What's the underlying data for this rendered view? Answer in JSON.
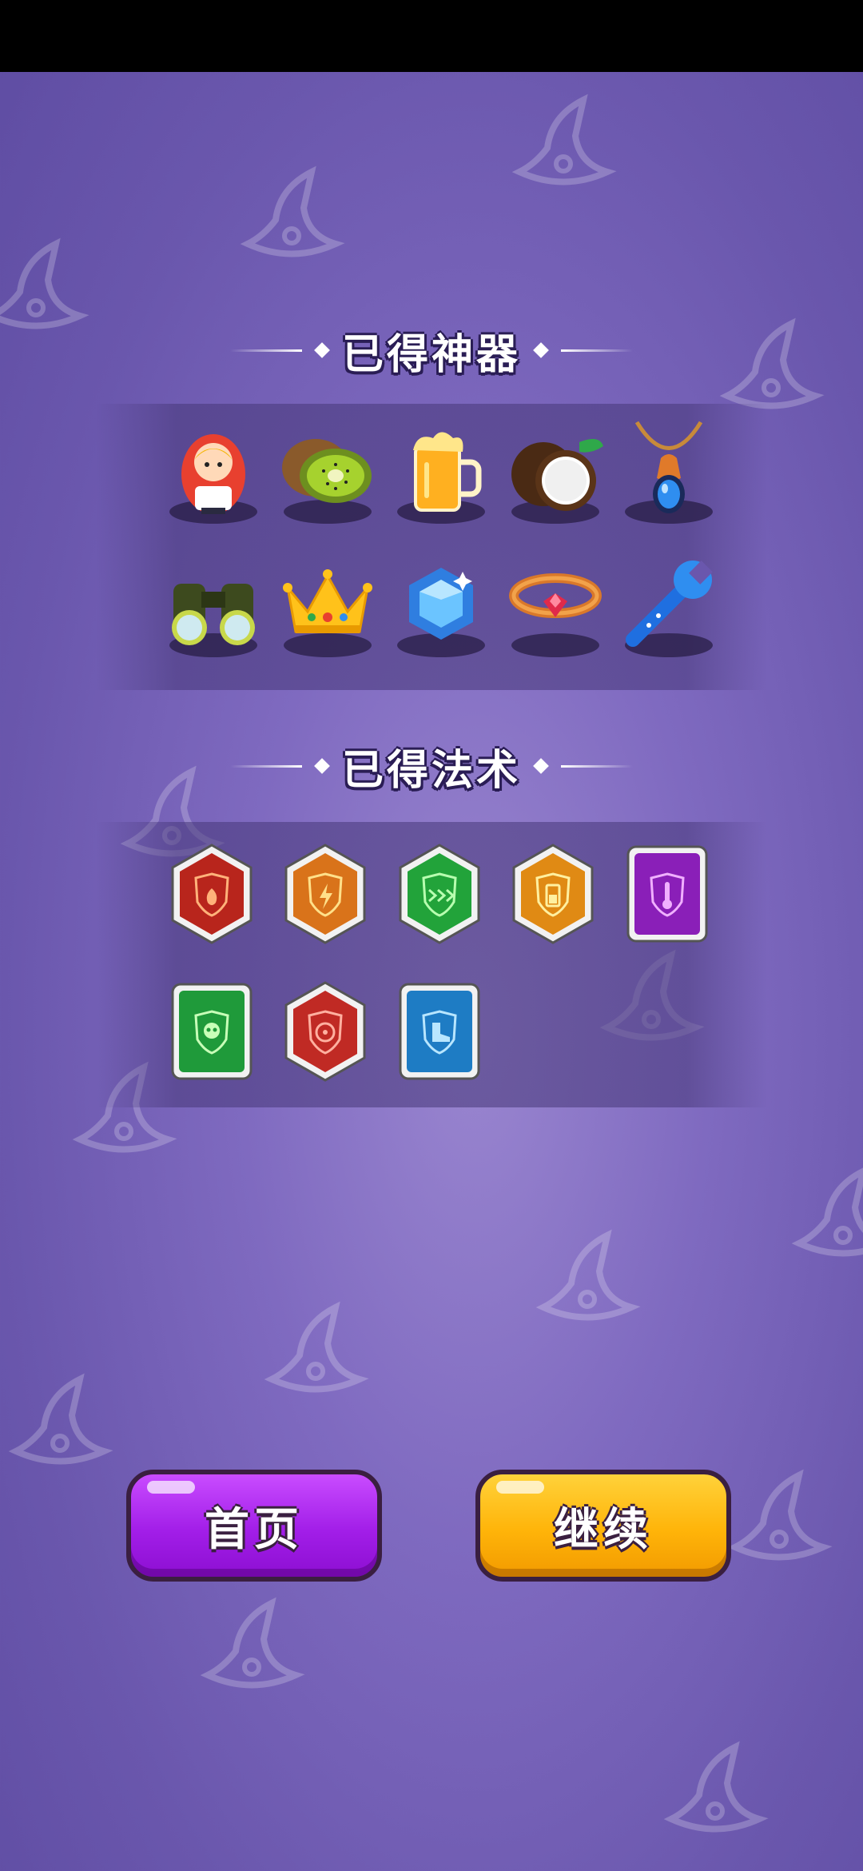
{
  "artifacts_section": {
    "title": "已得神器"
  },
  "spells_section": {
    "title": "已得法术"
  },
  "artifacts": [
    {
      "name": "nesting-doll"
    },
    {
      "name": "kiwi"
    },
    {
      "name": "beer-mug"
    },
    {
      "name": "coconut"
    },
    {
      "name": "pendant"
    },
    {
      "name": "binoculars"
    },
    {
      "name": "crown"
    },
    {
      "name": "blue-gem"
    },
    {
      "name": "ruby-ring"
    },
    {
      "name": "wrench"
    }
  ],
  "spells": [
    {
      "name": "fire-shield",
      "color": "#b8251c"
    },
    {
      "name": "lightning-shield",
      "color": "#d9731a"
    },
    {
      "name": "speed-shield",
      "color": "#22a33a"
    },
    {
      "name": "battery-shield",
      "color": "#e08a14"
    },
    {
      "name": "thermometer-shield",
      "color": "#8a1fb8"
    },
    {
      "name": "skull-shield",
      "color": "#1f9a3a"
    },
    {
      "name": "target-shield",
      "color": "#c02a24"
    },
    {
      "name": "boot-shield",
      "color": "#1e7cc4"
    }
  ],
  "buttons": {
    "home": "首页",
    "continue": "继续"
  }
}
